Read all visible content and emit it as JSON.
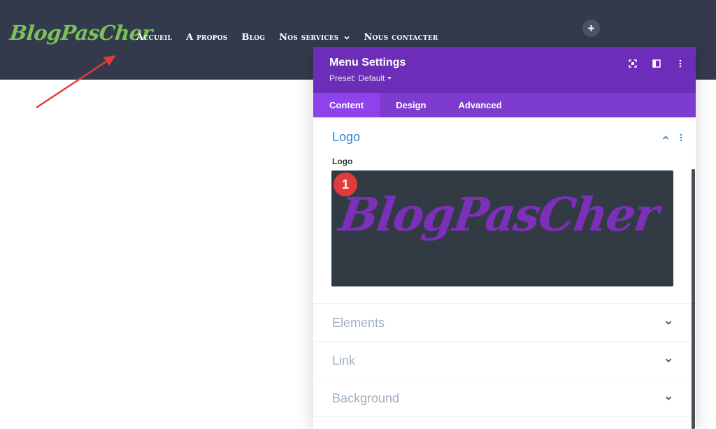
{
  "site": {
    "logo_text": "BlogPasCher",
    "nav": [
      {
        "label": "Accueil"
      },
      {
        "label": "A propos"
      },
      {
        "label": "Blog"
      },
      {
        "label": "Nos services"
      },
      {
        "label": "Nous contacter"
      }
    ],
    "add_label": "+"
  },
  "panel": {
    "title": "Menu Settings",
    "preset": "Preset: Default",
    "tabs": [
      {
        "label": "Content"
      },
      {
        "label": "Design"
      },
      {
        "label": "Advanced"
      }
    ],
    "open_section": {
      "title": "Logo",
      "field_label": "Logo",
      "preview_text": "BlogPasCher",
      "badge": "1"
    },
    "collapsed_sections": [
      {
        "title": "Elements"
      },
      {
        "title": "Link"
      },
      {
        "title": "Background"
      }
    ]
  },
  "colors": {
    "header_bg": "#323a4c",
    "logo_green": "#7cbf5b",
    "panel_purple": "#6c2eb9",
    "tab_active": "#8f42ec",
    "accent_blue": "#2b87da",
    "arrow_red": "#e33b3b"
  }
}
